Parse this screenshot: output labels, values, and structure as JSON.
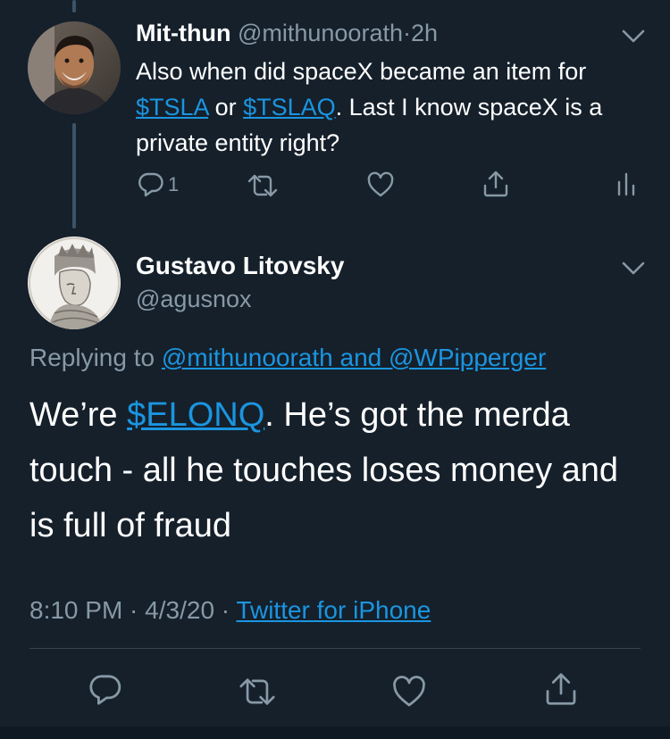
{
  "parent_tweet": {
    "display_name": "Mit-thun",
    "handle": "@mithunoorath",
    "separator": "·",
    "time": "2h",
    "text_parts": {
      "t1": "Also when did spaceX became an item for ",
      "cashtag1": "$TSLA",
      "t2": " or ",
      "cashtag2": "$TSLAQ",
      "t3": ". Last I know spaceX is a private entity right?"
    },
    "reply_count": "1",
    "icons": [
      "reply-icon",
      "retweet-icon",
      "like-icon",
      "share-icon",
      "analytics-icon",
      "chevron-down-icon"
    ]
  },
  "main_tweet": {
    "display_name": "Gustavo Litovsky",
    "handle": "@agusnox",
    "replying_prefix": "Replying to ",
    "replying_to": "@mithunoorath and @WPipperger",
    "text_parts": {
      "t1": "We’re ",
      "cashtag": "$ELONQ",
      "t2": ". He’s got the merda touch - all he touches loses money and is full of fraud"
    },
    "time": "8:10 PM",
    "date_separator": " · ",
    "date": "4/3/20",
    "source_separator": " · ",
    "source": "Twitter for iPhone",
    "icons": [
      "reply-icon",
      "retweet-icon",
      "like-icon",
      "share-icon",
      "chevron-down-icon"
    ]
  },
  "colors": {
    "background": "#15202b",
    "text": "#ffffff",
    "muted": "#8899a6",
    "link": "#1b95e0",
    "thread_line": "#3d5466"
  }
}
